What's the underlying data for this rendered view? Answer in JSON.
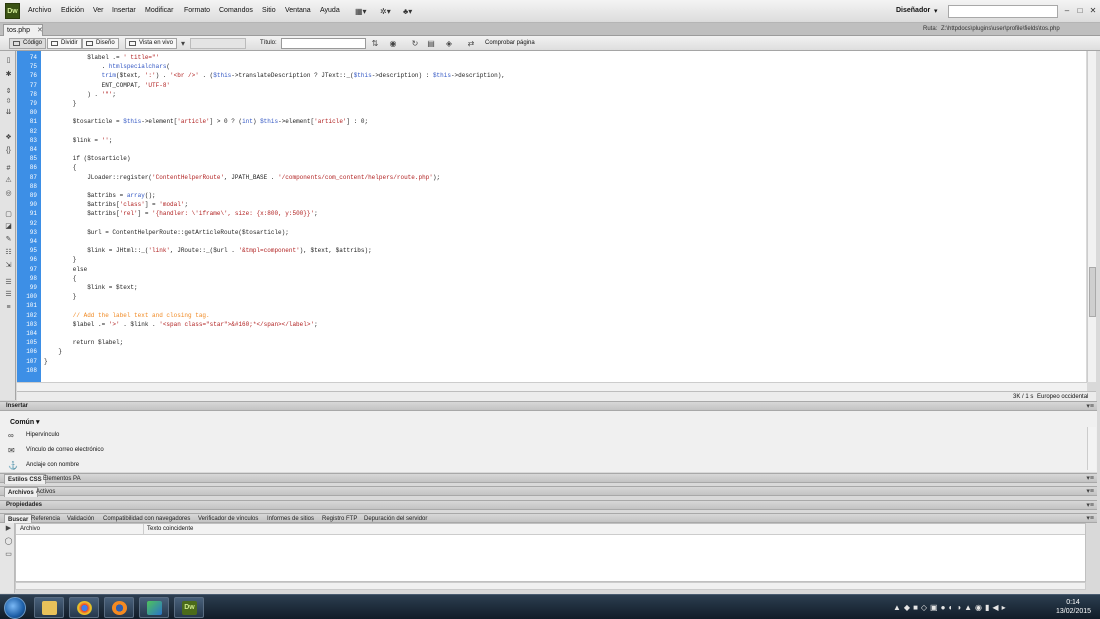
{
  "menubar": {
    "logo": "Dw",
    "items": [
      "Archivo",
      "Edición",
      "Ver",
      "Insertar",
      "Modificar",
      "Formato",
      "Comandos",
      "Sitio",
      "Ventana",
      "Ayuda"
    ],
    "workspace": "Diseñador",
    "icons": [
      "layout-icon",
      "gear-icon",
      "site-icon"
    ]
  },
  "tabbar": {
    "doc_tab": "tos.php",
    "path_label": "Ruta:",
    "path_value": "Z:\\httpdocs\\plugins\\user\\profile\\fields\\tos.php"
  },
  "doc_toolbar": {
    "code_label": "Código",
    "split_label": "Dividir",
    "design_label": "Diseño",
    "live_label": "Vista en vivo",
    "title_label": "Título:",
    "title_value": "",
    "check_label": "Comprobar página"
  },
  "editor": {
    "line_numbers": [
      "74",
      "75",
      "76",
      "77",
      "78",
      "79",
      "80",
      "81",
      "82",
      "83",
      "84",
      "85",
      "86",
      "87",
      "88",
      "89",
      "90",
      "91",
      "92",
      "93",
      "94",
      "95",
      "96",
      "97",
      "98",
      "99",
      "100",
      "101",
      "102",
      "103",
      "104",
      "105",
      "106",
      "107",
      "108"
    ]
  },
  "statusbar": {
    "size": "3K / 1 s",
    "encoding": "Europeo occidental"
  },
  "insert_panel": {
    "title": "Insertar",
    "category": "Común",
    "items": [
      "Hipervínculo",
      "Vínculo de correo electrónico",
      "Anclaje con nombre"
    ]
  },
  "css_panel": {
    "tabs": [
      "Estilos CSS",
      "Elementos PA"
    ]
  },
  "files_panel": {
    "tabs": [
      "Archivos",
      "Activos"
    ]
  },
  "properties_panel": {
    "title": "Propiedades"
  },
  "results_panel": {
    "tabs": [
      "Buscar",
      "Referencia",
      "Validación",
      "Compatibilidad con navegadores",
      "Verificador de vínculos",
      "Informes de sitios",
      "Registro FTP",
      "Depuración del servidor"
    ],
    "columns": [
      "Archivo",
      "Texto coincidente"
    ]
  },
  "taskbar": {
    "apps": [
      "explorer",
      "chrome",
      "firefox",
      "network",
      "dreamweaver"
    ],
    "time": "0:14",
    "date": "13/02/2015"
  },
  "colors": {
    "gutter": "#3d8fe6",
    "string": "#b01f1f",
    "variable": "#3458c4",
    "comment": "#f08a24"
  }
}
